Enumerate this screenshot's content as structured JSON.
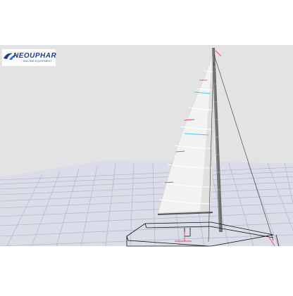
{
  "app": {
    "title": ""
  },
  "logo": {
    "brand": "NEOUPHAR",
    "tagline": "SAILING EQUIPMENT"
  },
  "scene": {
    "background_color": "#e3e3e6",
    "grid_color": "#a7b0c8",
    "floor_color": "#d9dce6",
    "sail_color": "#f3f3f3",
    "mast_color": "#6f6f6f",
    "batten_color": "#ffffff",
    "telltale_red": "#e0506a",
    "telltale_cyan": "#48c9e6",
    "hull_outline_color": "#111111",
    "rigging_color": "#333333"
  },
  "icons": {
    "logo_icon": "neouphar-logo-icon"
  }
}
